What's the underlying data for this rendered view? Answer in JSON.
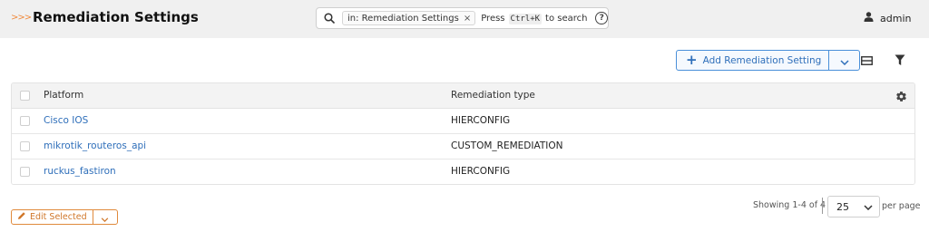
{
  "header": {
    "brand_chevrons": ">>>",
    "title": "Remediation Settings",
    "search": {
      "chip_label": "in: Remediation Settings",
      "chip_close": "×",
      "hint_before": "Press",
      "shortcut": "Ctrl+K",
      "hint_after": "to search",
      "help_glyph": "?"
    },
    "user": {
      "name": "admin",
      "icon": "user-icon"
    }
  },
  "toolbar": {
    "add_label": "Add Remediation Setting",
    "add_icon": "plus-icon",
    "accent_color": "#2f6fba"
  },
  "table": {
    "columns": [
      "Platform",
      "Remediation type"
    ],
    "rows": [
      {
        "platform": "Cisco IOS",
        "remediation_type": "HIERCONFIG"
      },
      {
        "platform": "mikrotik_routeros_api",
        "remediation_type": "CUSTOM_REMEDIATION"
      },
      {
        "platform": "ruckus_fastiron",
        "remediation_type": "HIERCONFIG"
      }
    ]
  },
  "pagination": {
    "showing": "Showing 1-4 of 4",
    "per_page_value": "25",
    "per_page_label": "per page"
  },
  "bulk": {
    "edit_label": "Edit Selected",
    "edit_color": "#d0772a"
  }
}
